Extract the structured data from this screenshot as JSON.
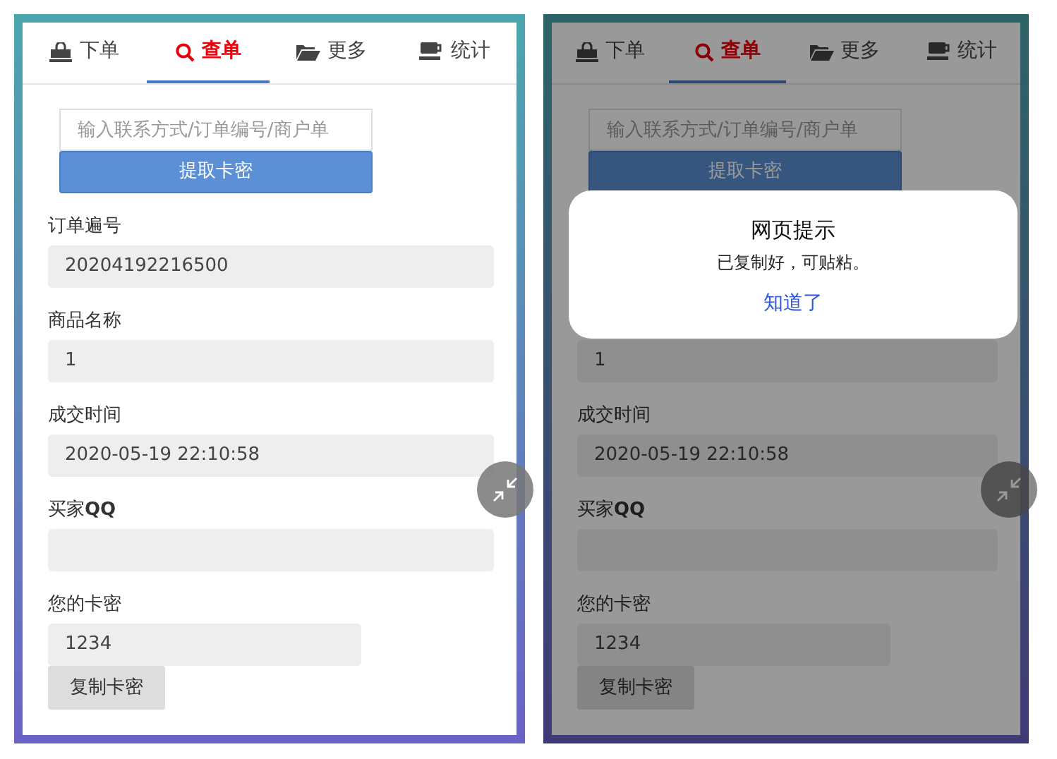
{
  "panels": [
    {
      "tabs": [
        {
          "label": "下单",
          "selected": false
        },
        {
          "label": "查单",
          "selected": true
        },
        {
          "label": "更多",
          "selected": false
        },
        {
          "label": "统计",
          "selected": false
        }
      ],
      "search": {
        "placeholder": "输入联系方式/订单编号/商户单"
      },
      "fetch_button": "提取卡密",
      "fields": [
        {
          "kind": "text",
          "label": "订单遍号",
          "value": "20204192216500"
        },
        {
          "kind": "text",
          "label": "商品名称",
          "value": "1"
        },
        {
          "kind": "text",
          "label": "成交时间",
          "value": "2020-05-19 22:10:58"
        },
        {
          "kind": "text",
          "label": "买家**QQ**"
        },
        {
          "kind": "secret",
          "label": "您的卡密",
          "value": "1234",
          "copy_button": "复制卡密"
        }
      ]
    },
    {
      "tabs": [
        {
          "label": "下单",
          "selected": false
        },
        {
          "label": "查单",
          "selected": true
        },
        {
          "label": "更多",
          "selected": false
        },
        {
          "label": "统计",
          "selected": false
        }
      ],
      "search": {
        "placeholder": "输入联系方式/订单编号/商户单"
      },
      "fetch_button": "提取卡密",
      "fields": [
        {
          "kind": "text",
          "value": "1"
        },
        {
          "kind": "text",
          "label": "成交时间",
          "value": "2020-05-19 22:10:58"
        },
        {
          "kind": "text",
          "label": "买家**QQ**"
        },
        {
          "kind": "secret",
          "label": "您的卡密",
          "value": "1234",
          "copy_button": "复制卡密"
        }
      ],
      "dialog": {
        "title": "网页提示",
        "message": "已复制好，可贴粘。",
        "button": "知道了"
      }
    }
  ]
}
